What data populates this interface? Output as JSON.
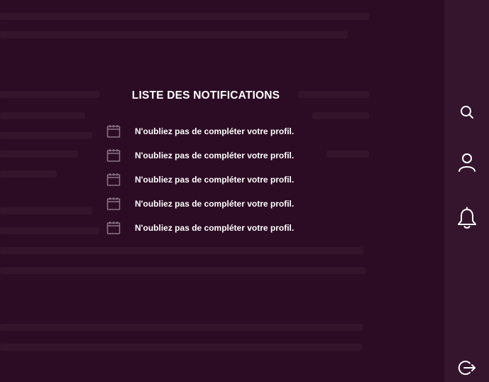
{
  "notifications": {
    "title": "LISTE DES NOTIFICATIONS",
    "items": [
      {
        "icon": "calendar-icon",
        "text": "N'oubliez pas de compléter votre profil."
      },
      {
        "icon": "calendar-icon",
        "text": "N'oubliez pas de compléter votre profil."
      },
      {
        "icon": "calendar-icon",
        "text": "N'oubliez pas de compléter votre profil."
      },
      {
        "icon": "calendar-icon",
        "text": "N'oubliez pas de compléter votre profil."
      },
      {
        "icon": "calendar-icon",
        "text": "N'oubliez pas de compléter votre profil."
      }
    ]
  },
  "sidebar": {
    "icons": [
      "search-icon",
      "user-icon",
      "bell-icon",
      "logout-icon"
    ]
  },
  "colors": {
    "background": "#2c0c24",
    "sidebar": "#35152d",
    "text": "#ffffff",
    "icon_muted": "#8a7784"
  }
}
